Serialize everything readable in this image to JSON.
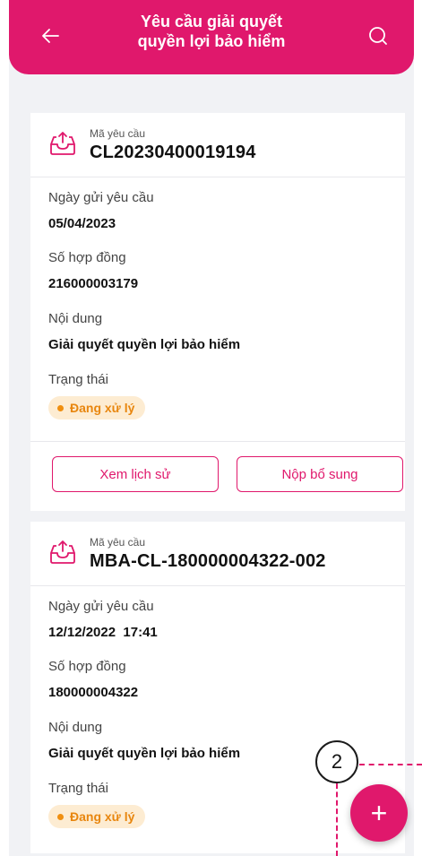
{
  "header": {
    "title_line1": "Yêu cầu giải quyết",
    "title_line2": "quyền lợi bảo hiểm",
    "back_icon": "arrow-left-icon",
    "search_icon": "search-icon"
  },
  "colors": {
    "brand": "#e0186c",
    "status_bg": "#fdecd2",
    "status_text": "#e8860e"
  },
  "claims": [
    {
      "code_label": "Mã yêu cầu",
      "code": "CL20230400019194",
      "date_label": "Ngày gửi yêu cầu",
      "date": "05/04/2023",
      "contract_label": "Số hợp đồng",
      "contract": "216000003179",
      "content_label": "Nội dung",
      "content": "Giải quyết quyền lợi bảo hiểm",
      "status_label": "Trạng thái",
      "status": "Đang xử lý",
      "history_button": "Xem lịch sử",
      "supplement_button": "Nộp bổ sung"
    },
    {
      "code_label": "Mã yêu cầu",
      "code": "MBA-CL-180000004322-002",
      "date_label": "Ngày gửi yêu cầu",
      "date": "12/12/2022  17:41",
      "contract_label": "Số hợp đồng",
      "contract": "180000004322",
      "content_label": "Nội dung",
      "content": "Giải quyết quyền lợi bảo hiểm",
      "status_label": "Trạng thái",
      "status": "Đang xử lý"
    }
  ],
  "fab": {
    "label": "+"
  },
  "annotation": {
    "number": "2"
  }
}
